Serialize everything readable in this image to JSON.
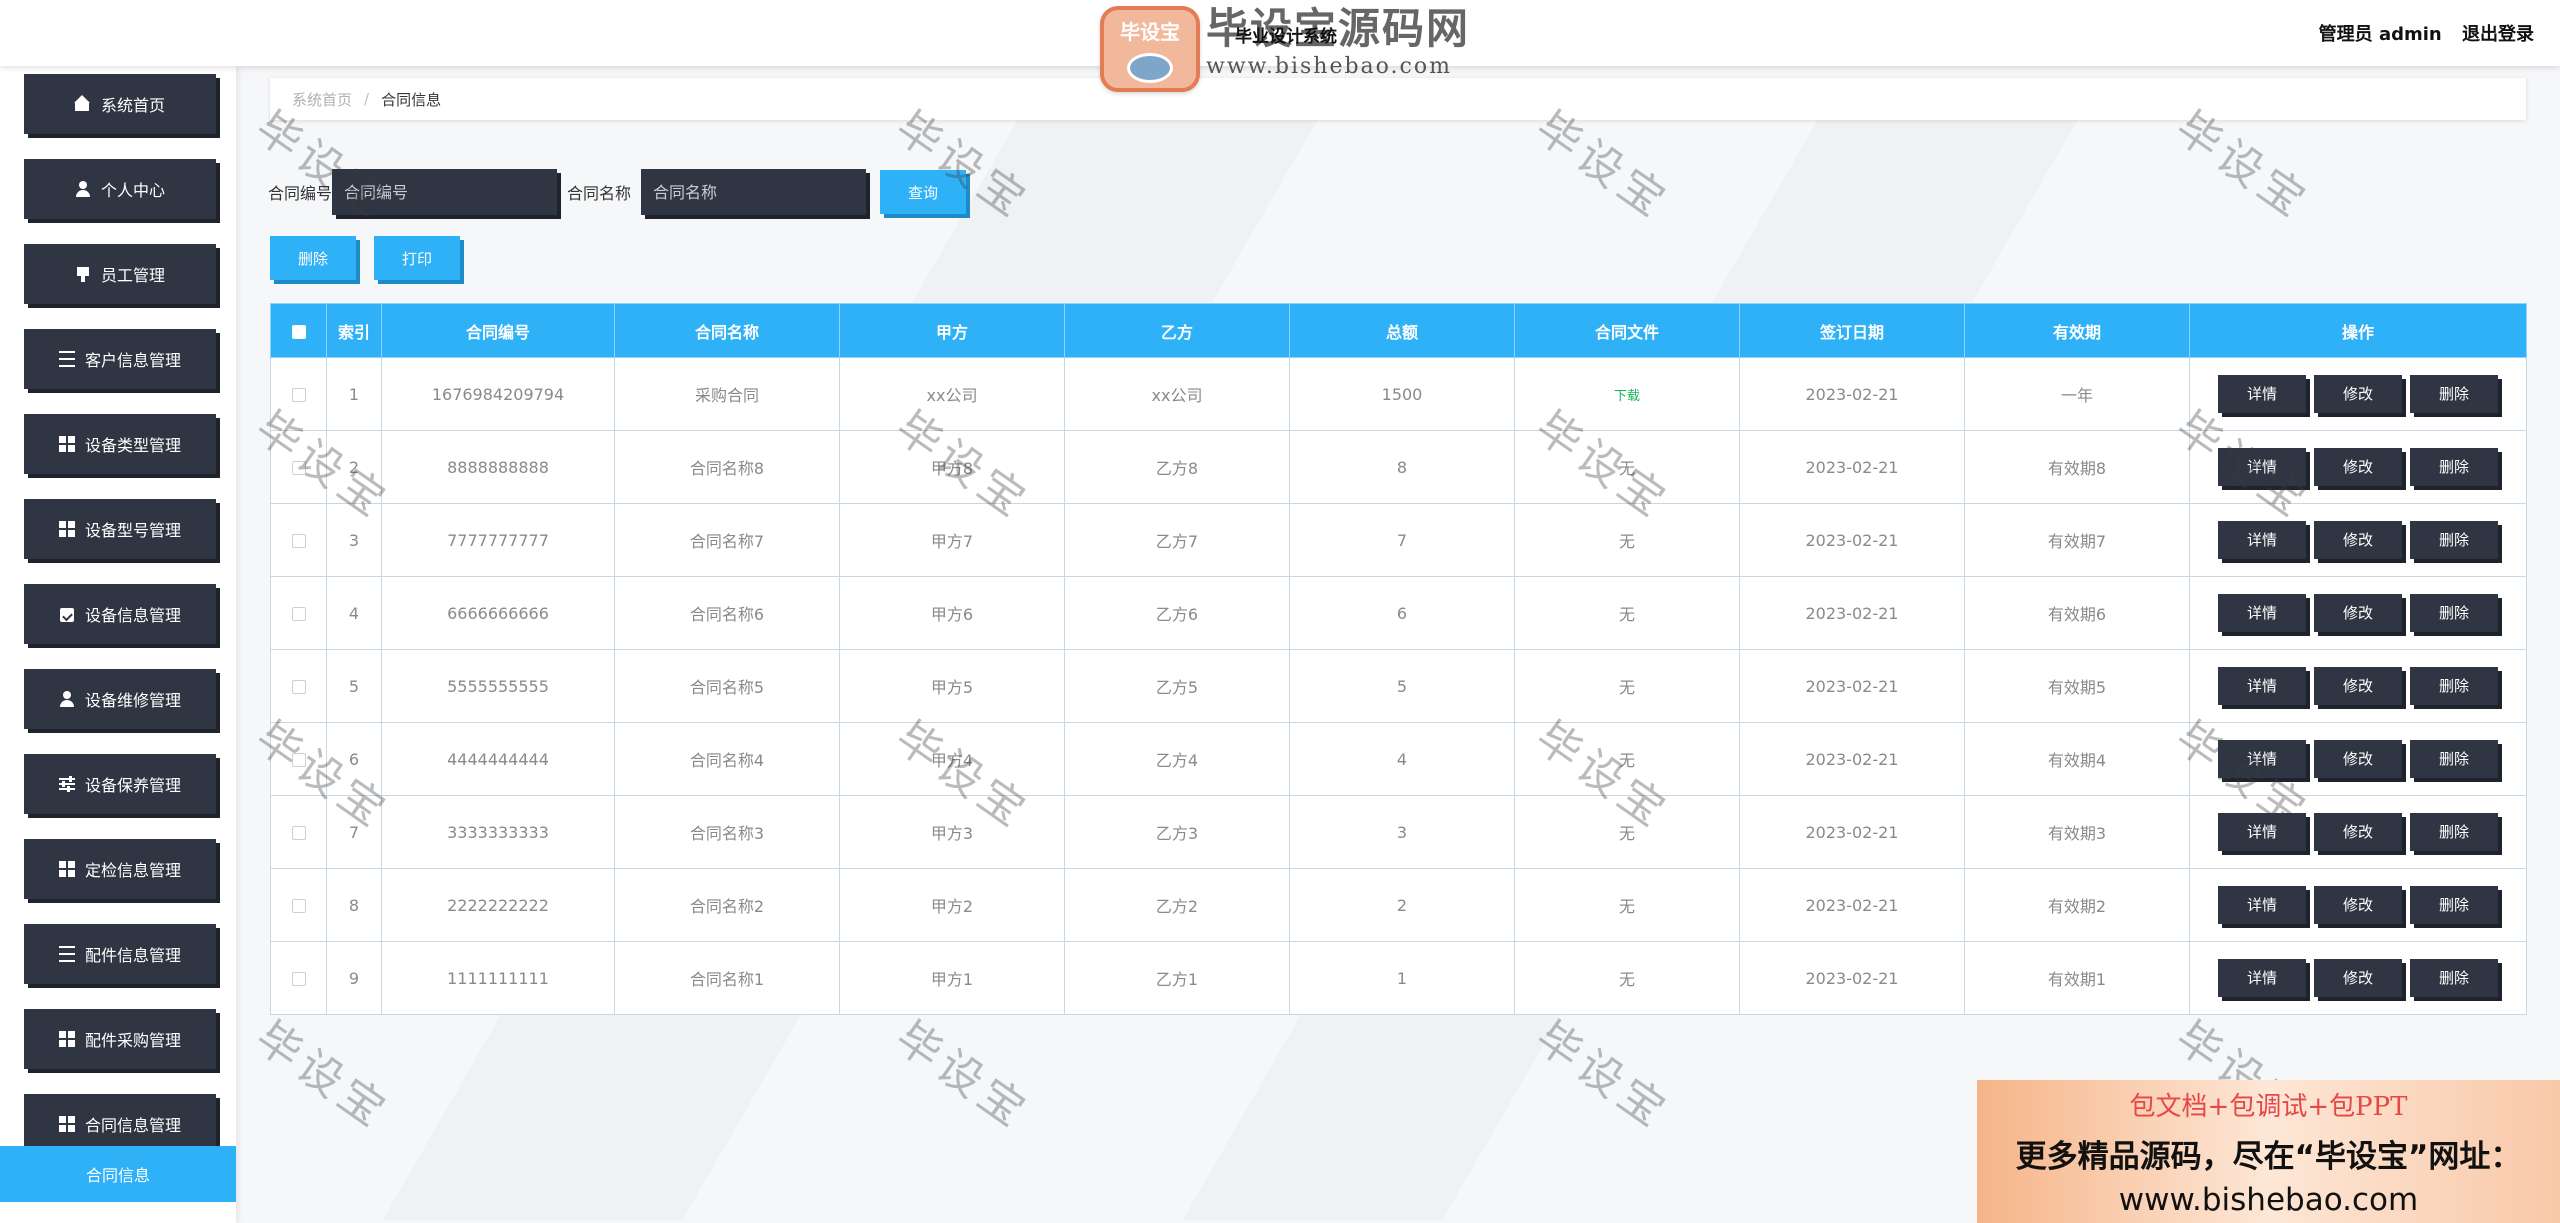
{
  "header": {
    "brand_seal_text": "毕设宝",
    "brand_title": "毕设宝源码网",
    "brand_overlay": "毕业设计系统",
    "brand_url": "www.bishebao.com",
    "role_label": "管理员 admin",
    "logout_label": "退出登录"
  },
  "sidebar": {
    "items": [
      {
        "label": "系统首页",
        "icon": "home-icon"
      },
      {
        "label": "个人中心",
        "icon": "user-icon"
      },
      {
        "label": "员工管理",
        "icon": "tag-icon"
      },
      {
        "label": "客户信息管理",
        "icon": "list-icon"
      },
      {
        "label": "设备类型管理",
        "icon": "grid-icon"
      },
      {
        "label": "设备型号管理",
        "icon": "grid-icon"
      },
      {
        "label": "设备信息管理",
        "icon": "clipboard-icon"
      },
      {
        "label": "设备维修管理",
        "icon": "user-icon"
      },
      {
        "label": "设备保养管理",
        "icon": "sliders-icon"
      },
      {
        "label": "定检信息管理",
        "icon": "grid-icon"
      },
      {
        "label": "配件信息管理",
        "icon": "list-icon"
      },
      {
        "label": "配件采购管理",
        "icon": "grid-icon"
      },
      {
        "label": "合同信息管理",
        "icon": "grid-icon"
      }
    ],
    "sub_item": "合同信息"
  },
  "breadcrumb": {
    "home": "系统首页",
    "separator": "/",
    "current": "合同信息"
  },
  "search": {
    "code_label": "合同编号",
    "code_placeholder": "合同编号",
    "name_label": "合同名称",
    "name_placeholder": "合同名称",
    "query_label": "查询"
  },
  "actions": {
    "delete_label": "删除",
    "print_label": "打印"
  },
  "table": {
    "columns": [
      "索引",
      "合同编号",
      "合同名称",
      "甲方",
      "乙方",
      "总额",
      "合同文件",
      "签订日期",
      "有效期",
      "操作"
    ],
    "op_labels": {
      "detail": "详情",
      "edit": "修改",
      "delete": "删除"
    },
    "rows": [
      {
        "index": "1",
        "code": "1676984209794",
        "name": "采购合同",
        "party_a": "xx公司",
        "party_b": "xx公司",
        "total": "1500",
        "file": "下载",
        "date": "2023-02-21",
        "validity": "一年"
      },
      {
        "index": "2",
        "code": "8888888888",
        "name": "合同名称8",
        "party_a": "甲方8",
        "party_b": "乙方8",
        "total": "8",
        "file": "无",
        "date": "2023-02-21",
        "validity": "有效期8"
      },
      {
        "index": "3",
        "code": "7777777777",
        "name": "合同名称7",
        "party_a": "甲方7",
        "party_b": "乙方7",
        "total": "7",
        "file": "无",
        "date": "2023-02-21",
        "validity": "有效期7"
      },
      {
        "index": "4",
        "code": "6666666666",
        "name": "合同名称6",
        "party_a": "甲方6",
        "party_b": "乙方6",
        "total": "6",
        "file": "无",
        "date": "2023-02-21",
        "validity": "有效期6"
      },
      {
        "index": "5",
        "code": "5555555555",
        "name": "合同名称5",
        "party_a": "甲方5",
        "party_b": "乙方5",
        "total": "5",
        "file": "无",
        "date": "2023-02-21",
        "validity": "有效期5"
      },
      {
        "index": "6",
        "code": "4444444444",
        "name": "合同名称4",
        "party_a": "甲方4",
        "party_b": "乙方4",
        "total": "4",
        "file": "无",
        "date": "2023-02-21",
        "validity": "有效期4"
      },
      {
        "index": "7",
        "code": "3333333333",
        "name": "合同名称3",
        "party_a": "甲方3",
        "party_b": "乙方3",
        "total": "3",
        "file": "无",
        "date": "2023-02-21",
        "validity": "有效期3"
      },
      {
        "index": "8",
        "code": "2222222222",
        "name": "合同名称2",
        "party_a": "甲方2",
        "party_b": "乙方2",
        "total": "2",
        "file": "无",
        "date": "2023-02-21",
        "validity": "有效期2"
      },
      {
        "index": "9",
        "code": "1111111111",
        "name": "合同名称1",
        "party_a": "甲方1",
        "party_b": "乙方1",
        "total": "1",
        "file": "无",
        "date": "2023-02-21",
        "validity": "有效期1"
      }
    ]
  },
  "watermark_text": "毕设宝",
  "promo": {
    "line1": "包文档+包调试+包PPT",
    "line2": "更多精品源码，尽在“毕设宝”网址：",
    "line3": "www.bishebao.com"
  },
  "colors": {
    "accent": "#2fb1f7",
    "dark_button": "#2f3542",
    "download_link": "#1bb35a"
  }
}
